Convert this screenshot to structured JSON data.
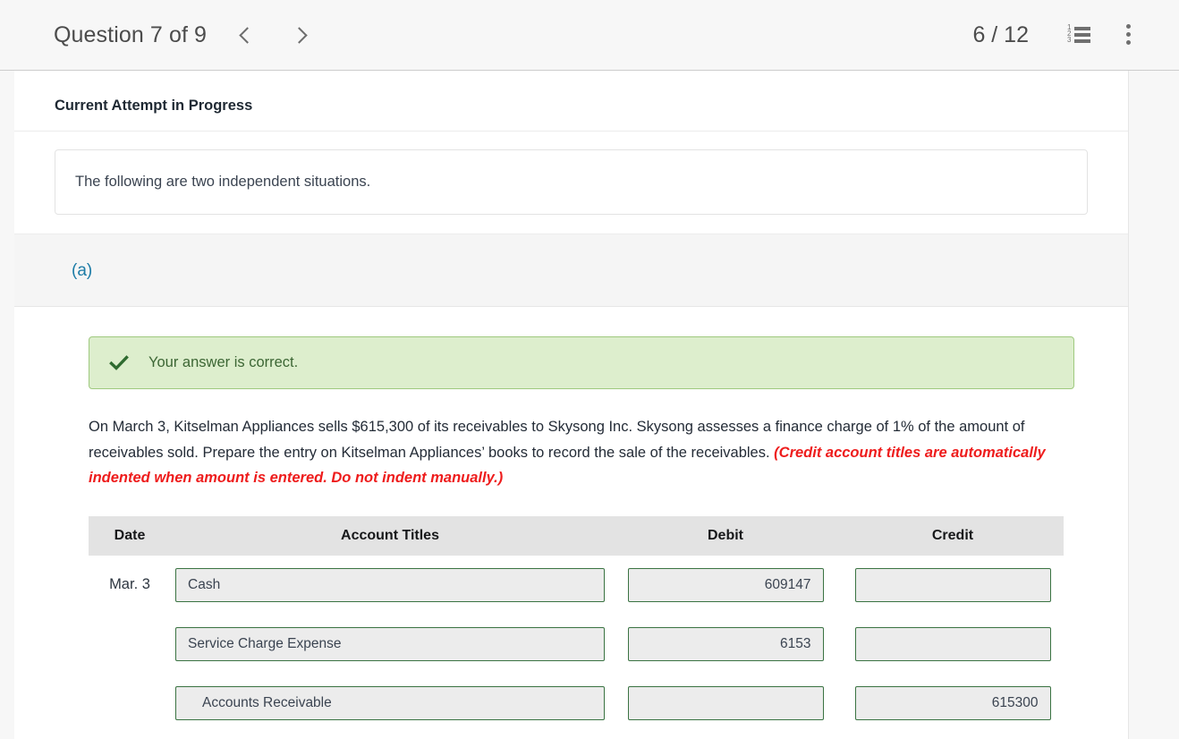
{
  "header": {
    "question_title": "Question 7 of 9",
    "prev_icon": "chevron-left-icon",
    "next_icon": "chevron-right-icon",
    "progress": "6 / 12",
    "list_icon": "numbered-list-icon",
    "list_icon_numbers": [
      "1",
      "2",
      "3"
    ],
    "menu_icon": "kebab-menu-icon"
  },
  "attempt": {
    "heading": "Current Attempt in Progress"
  },
  "situation": {
    "text": "The following are two independent situations."
  },
  "part": {
    "label": "(a)",
    "alert": {
      "icon": "check-icon",
      "text": "Your answer is correct."
    },
    "prompt": {
      "body": "On March 3, Kitselman Appliances sells $615,300 of its receivables to Skysong Inc. Skysong assesses a finance charge of 1% of the amount of receivables sold. Prepare the entry on Kitselman Appliances’ books to record the sale of the receivables. ",
      "hint": "(Credit account titles are automatically indented when amount is entered. Do not indent manually.)"
    }
  },
  "journal": {
    "columns": [
      "Date",
      "Account Titles",
      "Debit",
      "Credit"
    ],
    "rows": [
      {
        "date": "Mar. 3",
        "account": "Cash",
        "indent": false,
        "debit": "609147",
        "credit": ""
      },
      {
        "date": "",
        "account": "Service Charge Expense",
        "indent": false,
        "debit": "6153",
        "credit": ""
      },
      {
        "date": "",
        "account": "Accounts Receivable",
        "indent": true,
        "debit": "",
        "credit": "615300"
      }
    ]
  },
  "colors": {
    "accent_blue": "#1b7ba6",
    "alert_bg": "#ddeecd",
    "alert_border": "#9fc97f",
    "alert_text": "#3c6634",
    "hint_red": "#ee1c1c",
    "field_border_green": "#3a7342",
    "field_bg": "#ececec"
  }
}
